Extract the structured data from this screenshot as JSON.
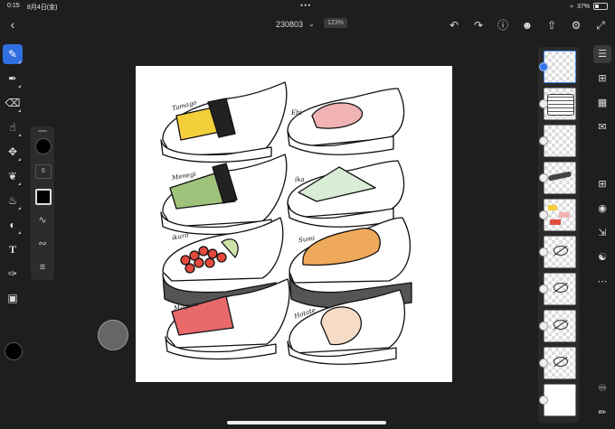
{
  "status": {
    "time": "0:15",
    "date": "8月4日(金)",
    "dots": "•••",
    "battery": "37%",
    "battery_level": 0.37
  },
  "header": {
    "title": "230803",
    "zoom": "123%"
  },
  "toolbar_icons": [
    "undo-icon",
    "redo-icon",
    "help-icon",
    "share-icon",
    "export-icon",
    "settings-icon",
    "expand-icon"
  ],
  "left_tools": [
    "pixel-brush-icon",
    "paint-brush-icon",
    "eraser-icon",
    "smudge-icon",
    "transform-icon",
    "lasso-icon",
    "fill-icon",
    "shape-icon",
    "text-icon",
    "eyedropper-icon",
    "image-icon"
  ],
  "mini_panel": {
    "size": "6"
  },
  "canvas_labels": [
    "Tamago",
    "Ebi",
    "Menegi",
    "ika",
    "ikura",
    "Sumi",
    "Maguro",
    "Hotate"
  ],
  "colors": {
    "accent": "#2f6fe0",
    "tamago": "#f3cf3a",
    "ebi": "#f1b3b3",
    "menegi": "#9fc27a",
    "ika": "#d9ecd6",
    "ikura": "#e2493d",
    "sumi": "#efa95b",
    "maguro": "#e86a6a",
    "hotate": "#f6dcc7",
    "sole": "#555555"
  },
  "layers_count": 10,
  "right_tools": [
    "layers-icon",
    "adjustments-icon",
    "grid-icon",
    "comments-icon",
    "add-layer-icon",
    "visibility-icon",
    "import-icon",
    "blend-icon",
    "more-icon",
    "masks-icon",
    "ruler-icon"
  ]
}
